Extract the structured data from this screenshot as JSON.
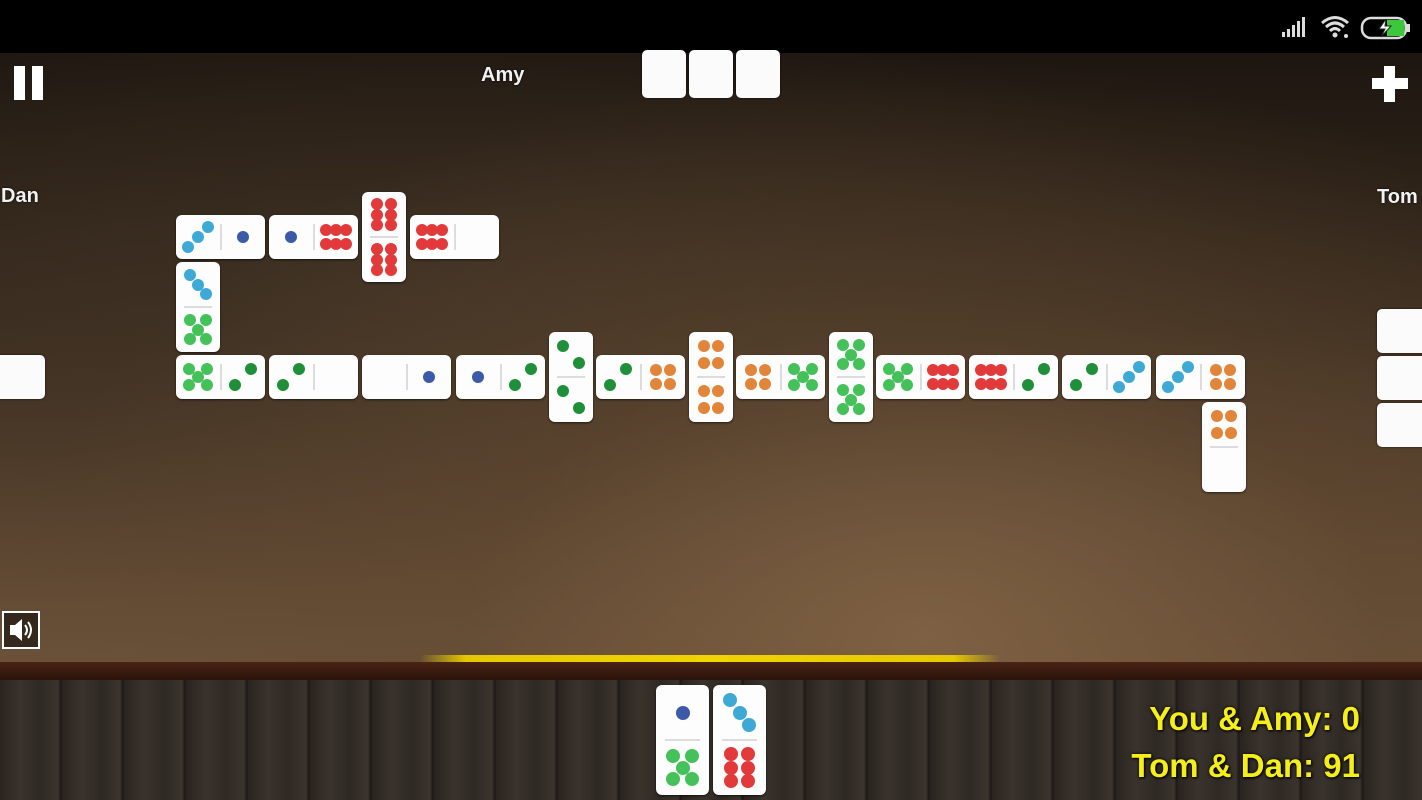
{
  "status_bar": {
    "icons": [
      "signal-icon",
      "wifi-icon",
      "battery-charging-icon"
    ],
    "battery_color": "#3cc83c"
  },
  "controls": {
    "pause_icon": "pause-icon",
    "add_icon": "plus-icon",
    "sound_icon": "speaker-icon"
  },
  "players": {
    "top": {
      "name": "Amy",
      "hidden_tiles": 3
    },
    "left": {
      "name": "Dan",
      "hidden_tiles": 1
    },
    "right": {
      "name": "Tom",
      "hidden_tiles": 3
    }
  },
  "pip_colors": {
    "1": "#3d5aa8",
    "2": "#1f8f3a",
    "3": "#3fa9d6",
    "4": "#e0853a",
    "5": "#45c15a",
    "6": "#e23a3a"
  },
  "board_tiles": [
    {
      "a": 3,
      "b": 1,
      "orientation": "horizontal"
    },
    {
      "a": 1,
      "b": 6,
      "orientation": "horizontal"
    },
    {
      "a": 6,
      "b": 6,
      "orientation": "vertical"
    },
    {
      "a": 6,
      "b": 0,
      "orientation": "horizontal"
    },
    {
      "a": 3,
      "b": 5,
      "orientation": "vertical"
    },
    {
      "a": 5,
      "b": 2,
      "orientation": "horizontal"
    },
    {
      "a": 2,
      "b": 0,
      "orientation": "horizontal"
    },
    {
      "a": 0,
      "b": 1,
      "orientation": "horizontal"
    },
    {
      "a": 1,
      "b": 2,
      "orientation": "horizontal"
    },
    {
      "a": 2,
      "b": 2,
      "orientation": "vertical"
    },
    {
      "a": 2,
      "b": 4,
      "orientation": "horizontal"
    },
    {
      "a": 4,
      "b": 4,
      "orientation": "vertical"
    },
    {
      "a": 4,
      "b": 5,
      "orientation": "horizontal"
    },
    {
      "a": 5,
      "b": 5,
      "orientation": "vertical"
    },
    {
      "a": 5,
      "b": 6,
      "orientation": "horizontal"
    },
    {
      "a": 6,
      "b": 2,
      "orientation": "horizontal"
    },
    {
      "a": 2,
      "b": 3,
      "orientation": "horizontal"
    },
    {
      "a": 3,
      "b": 4,
      "orientation": "horizontal"
    },
    {
      "a": 4,
      "b": 0,
      "orientation": "vertical"
    }
  ],
  "hand_tiles": [
    {
      "a": 1,
      "b": 5
    },
    {
      "a": 3,
      "b": 6
    }
  ],
  "scores": {
    "team1": "You & Amy: 0",
    "team2": "Tom & Dan: 91"
  }
}
